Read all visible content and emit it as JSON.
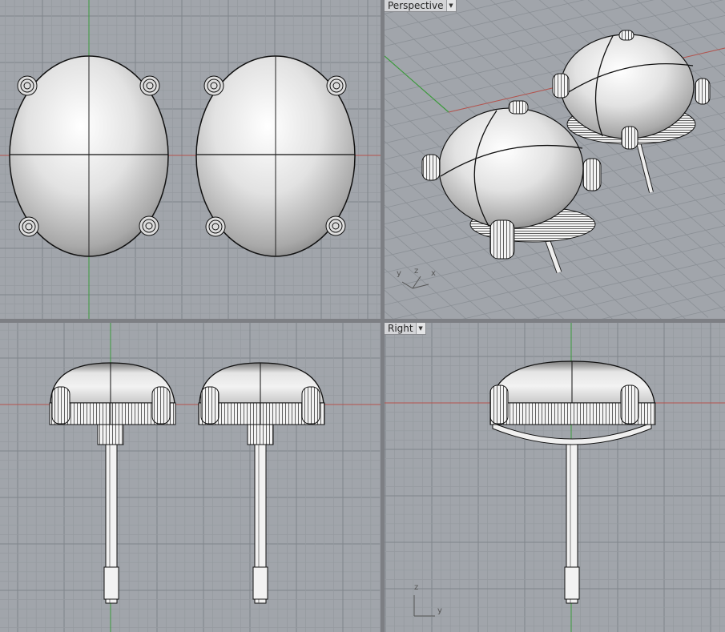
{
  "viewports": {
    "top": {
      "label": ""
    },
    "perspective": {
      "label": "Perspective",
      "dropdown_icon": "triangle-down-icon"
    },
    "front": {
      "label": ""
    },
    "right": {
      "label": "Right",
      "dropdown_icon": "triangle-down-icon"
    }
  },
  "axes": {
    "perspective": {
      "y": "y",
      "z": "z",
      "x": "x"
    },
    "right": {
      "z": "z",
      "y": "y"
    }
  },
  "colors": {
    "background": "#a1a5ab",
    "grid_minor": "#959a9f",
    "grid_major": "#7f858b",
    "x_axis": "#b5534d",
    "y_axis": "#3c9a3c",
    "separator": "#f0f0f0"
  }
}
